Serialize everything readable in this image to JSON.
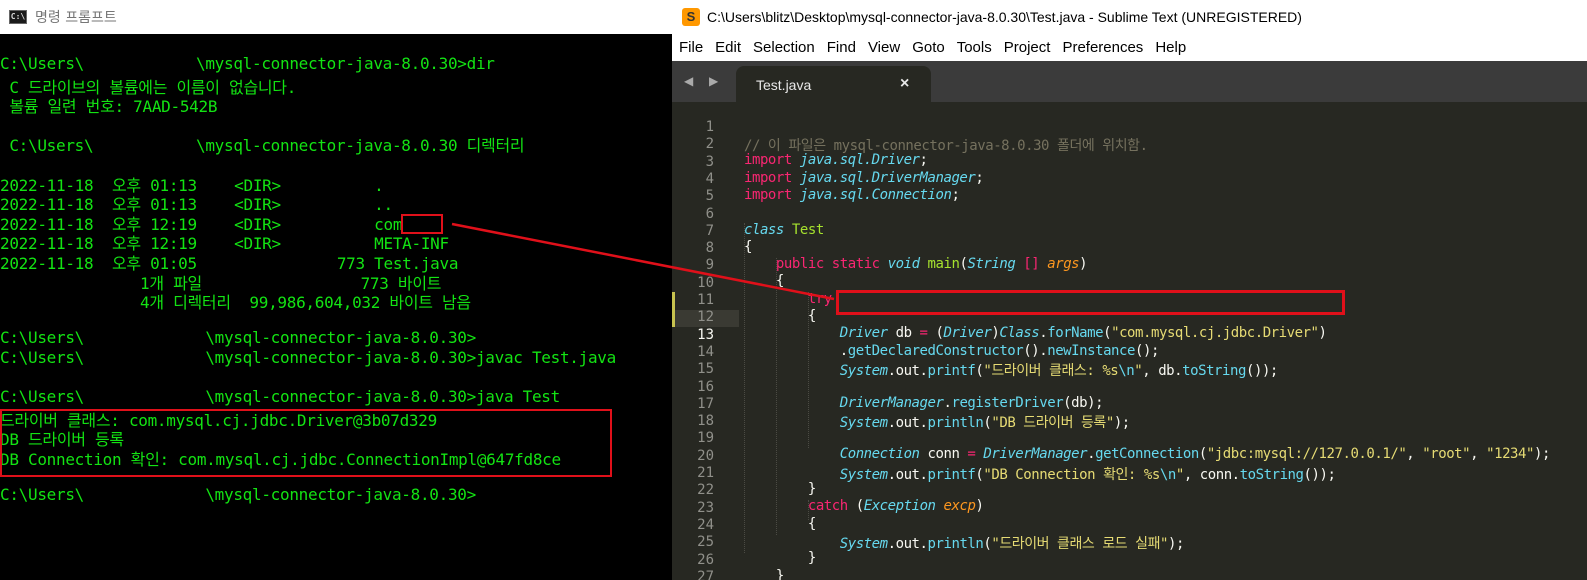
{
  "cmd": {
    "title": "명령 프롬프트",
    "icon": "cmd-icon",
    "lines": [
      "C:\\Users\\            \\mysql-connector-java-8.0.30>dir",
      " C 드라이브의 볼륨에는 이름이 없습니다.",
      " 볼륨 일련 번호: 7AAD-542B",
      "",
      " C:\\Users\\           \\mysql-connector-java-8.0.30 디렉터리",
      "",
      "2022-11-18  오후 01:13    <DIR>          .",
      "2022-11-18  오후 01:13    <DIR>          ..",
      "2022-11-18  오후 12:19    <DIR>          com",
      "2022-11-18  오후 12:19    <DIR>          META-INF",
      "2022-11-18  오후 01:05               773 Test.java",
      "               1개 파일                 773 바이트",
      "               4개 디렉터리  99,986,604,032 바이트 남음",
      "",
      "C:\\Users\\             \\mysql-connector-java-8.0.30>",
      "C:\\Users\\             \\mysql-connector-java-8.0.30>javac Test.java",
      "",
      "C:\\Users\\             \\mysql-connector-java-8.0.30>java Test",
      "드라이버 클래스: com.mysql.cj.jdbc.Driver@3b07d329",
      "DB 드라이버 등록",
      "DB Connection 확인: com.mysql.cj.jdbc.ConnectionImpl@647fd8ce",
      "",
      "C:\\Users\\             \\mysql-connector-java-8.0.30>"
    ]
  },
  "sublime": {
    "title": "C:\\Users\\blitz\\Desktop\\mysql-connector-java-8.0.30\\Test.java - Sublime Text (UNREGISTERED)",
    "icon": "sublime-icon",
    "menu": [
      "File",
      "Edit",
      "Selection",
      "Find",
      "View",
      "Goto",
      "Tools",
      "Project",
      "Preferences",
      "Help"
    ],
    "nav_arrows": "◀ ▶",
    "tab": {
      "label": "Test.java",
      "close": "×"
    },
    "line_numbers": [
      "1",
      "2",
      "3",
      "4",
      "5",
      "6",
      "7",
      "8",
      "9",
      "10",
      "11",
      "12",
      "13",
      "14",
      "15",
      "16",
      "17",
      "18",
      "19",
      "20",
      "21",
      "22",
      "23",
      "24",
      "25",
      "26",
      "27"
    ],
    "code": {
      "l1": {
        "comment": "// 이 파일은 mysql-connector-java-8.0.30 폴더에 위치함."
      },
      "l2": {
        "kw": "import",
        "pkg": "java.sql.Driver",
        "end": ";"
      },
      "l3": {
        "kw": "import",
        "pkg": "java.sql.DriverManager",
        "end": ";"
      },
      "l4": {
        "kw": "import",
        "pkg": "java.sql.Connection",
        "end": ";"
      },
      "l6": {
        "kw": "class",
        "name": "Test"
      },
      "l7": {
        "brace": "{"
      },
      "l8": {
        "kw1": "public",
        "kw2": "static",
        "ty": "void",
        "fn": "main",
        "p1": "(",
        "ty2": "String",
        "arr": " [] ",
        "arg": "args",
        "p2": ")"
      },
      "l9": {
        "brace": "{"
      },
      "l10": {
        "kw": "try"
      },
      "l11": {
        "brace": "{"
      },
      "l12": {
        "ty": "Driver",
        "var": " db ",
        "op": "=",
        "p1": " (",
        "ty2": "Driver",
        "p2": ")",
        "cls": "Class",
        "dot": ".",
        "fn": "forName",
        "p3": "(",
        "str": "\"com.mysql.cj.jdbc.Driver\"",
        "p4": ")"
      },
      "l13": {
        "dot": ".",
        "fn": "getDeclaredConstructor",
        "p1": "().",
        "fn2": "newInstance",
        "p2": "();"
      },
      "l14": {
        "ty": "System",
        "mid": ".out.",
        "fn": "printf",
        "p1": "(",
        "str": "\"드라이버 클래스: %s",
        "esc": "\\n",
        "str2": "\"",
        "p2": ", db.",
        "fn2": "toString",
        "p3": "());"
      },
      "l16": {
        "ty": "DriverManager",
        "dot": ".",
        "fn": "registerDriver",
        "p1": "(db);"
      },
      "l17": {
        "ty": "System",
        "mid": ".out.",
        "fn": "println",
        "p1": "(",
        "str": "\"DB 드라이버 등록\"",
        "p2": ");"
      },
      "l19": {
        "ty": "Connection",
        "var": " conn ",
        "op": "=",
        "sp": " ",
        "ty2": "DriverManager",
        "dot": ".",
        "fn": "getConnection",
        "p1": "(",
        "str1": "\"jdbc:mysql://127.0.0.1/\"",
        "c1": ", ",
        "str2": "\"root\"",
        "c2": ", ",
        "str3": "\"1234\"",
        "p2": ");"
      },
      "l20": {
        "ty": "System",
        "mid": ".out.",
        "fn": "printf",
        "p1": "(",
        "str": "\"DB Connection 확인: %s",
        "esc": "\\n",
        "str2": "\"",
        "p2": ", conn.",
        "fn2": "toString",
        "p3": "());"
      },
      "l21": {
        "brace": "}"
      },
      "l22": {
        "kw": "catch",
        "p1": " (",
        "ty": "Exception",
        "sp": " ",
        "arg": "excp",
        "p2": ")"
      },
      "l23": {
        "brace": "{"
      },
      "l24": {
        "ty": "System",
        "mid": ".out.",
        "fn": "println",
        "p1": "(",
        "str": "\"드라이버 클래스 로드 실패\"",
        "p2": ");"
      },
      "l25": {
        "brace": "}"
      },
      "l26": {
        "brace": "}"
      },
      "l27": {
        "brace": "}"
      }
    }
  },
  "colors": {
    "cmd_text": "#13e313",
    "highlight_box": "#e0101a",
    "editor_bg": "#272822",
    "keyword": "#f92672",
    "type": "#66d9ef",
    "function": "#a6e22e",
    "string": "#e6db74",
    "comment": "#75715e",
    "argument": "#fd971f"
  }
}
